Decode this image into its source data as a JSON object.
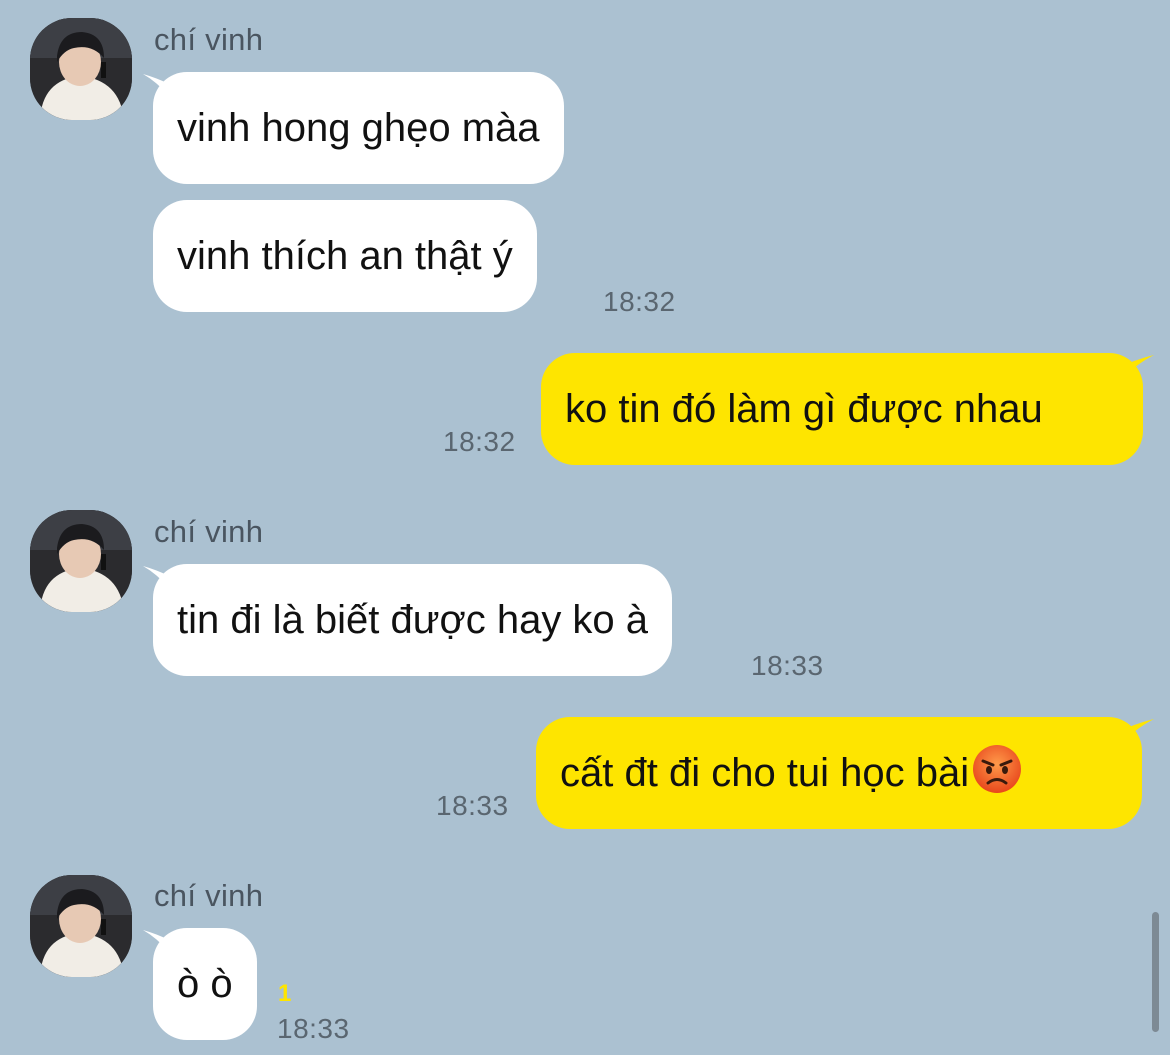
{
  "contact": {
    "name": "chí vinh"
  },
  "messages": [
    {
      "from": "contact",
      "text": "vinh hong ghẹo màa"
    },
    {
      "from": "contact",
      "text": "vinh thích an thật ý",
      "time": "18:32"
    },
    {
      "from": "me",
      "text": "ko tin đó làm gì được nhau",
      "time": "18:32"
    },
    {
      "from": "contact",
      "text": "tin đi là biết được hay ko à",
      "time": "18:33"
    },
    {
      "from": "me",
      "text": "cất đt đi cho tui học bài",
      "emoji": "angry-face-emoji",
      "time": "18:33"
    },
    {
      "from": "contact",
      "text": "ò ò",
      "unread": "1",
      "time": "18:33"
    }
  ],
  "colors": {
    "background": "#abc1d1",
    "incoming_bubble": "#ffffff",
    "outgoing_bubble": "#fee500",
    "unread_count": "#fee500"
  }
}
